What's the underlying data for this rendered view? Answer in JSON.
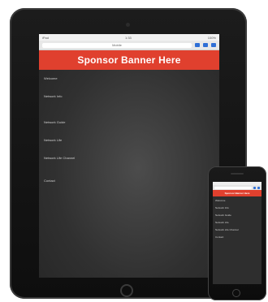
{
  "tablet": {
    "status": {
      "carrier": "iPad",
      "time": "1:33",
      "battery": "100%"
    },
    "address_bar": {
      "title": "Mobile"
    },
    "banner": {
      "text": "Sponsor Banner Here"
    },
    "menu": [
      {
        "label": "Welcome"
      },
      {
        "label": "Network Info"
      },
      {
        "label": "Network Guide"
      },
      {
        "label": "Network Life"
      },
      {
        "label": "Network Life Channel"
      },
      {
        "label": "Contact"
      }
    ]
  },
  "phone": {
    "banner": {
      "text": "Sponsor Banner Here"
    },
    "menu": [
      {
        "label": "Welcome"
      },
      {
        "label": "Network Info"
      },
      {
        "label": "Network Guide"
      },
      {
        "label": "Network Life"
      },
      {
        "label": "Network Life Channel"
      },
      {
        "label": "Contact"
      }
    ]
  },
  "colors": {
    "banner": "#e0402e",
    "screen_bg": "#333333",
    "device_body": "#141414",
    "nav_icon": "#2f6fd6"
  }
}
